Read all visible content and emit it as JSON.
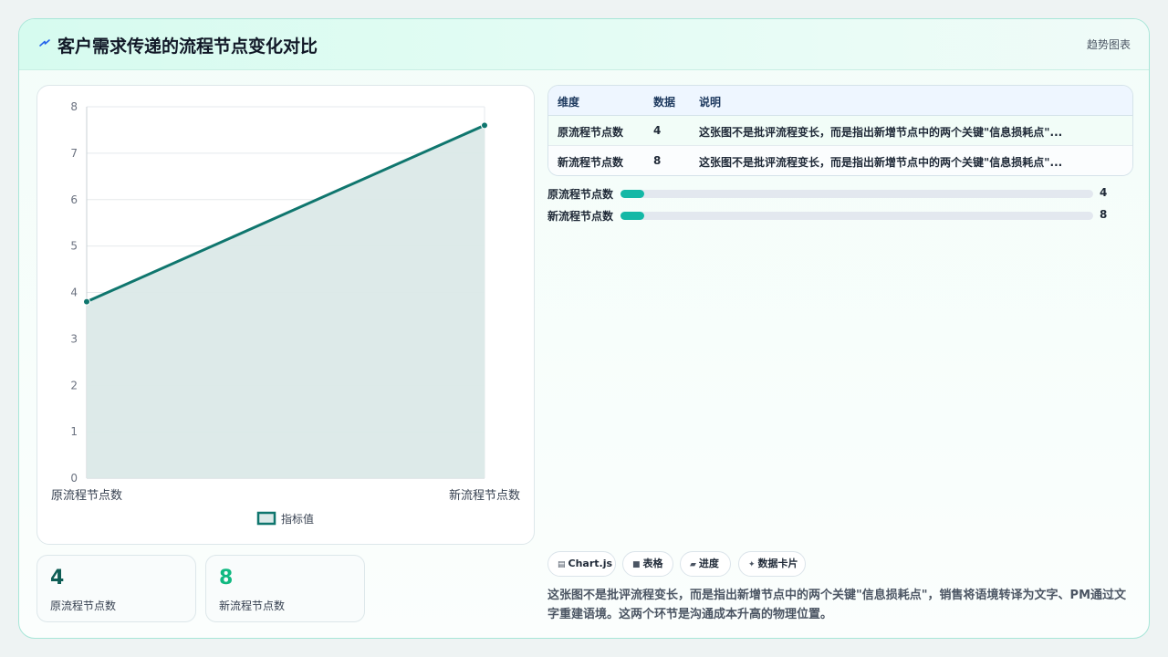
{
  "header": {
    "title": "客户需求传递的流程节点变化对比",
    "type_tag": "趋势图表",
    "icon": "lightning-icon"
  },
  "chart_data": {
    "type": "area",
    "categories": [
      "原流程节点数",
      "新流程节点数"
    ],
    "series": [
      {
        "name": "指标值",
        "values": [
          3.8,
          7.6
        ]
      }
    ],
    "ylim": [
      0,
      8
    ],
    "yticks": [
      0,
      1,
      2,
      3,
      4,
      5,
      6,
      7,
      8
    ],
    "grid": true,
    "legend_position": "bottom",
    "colors": {
      "line": "#0f766e",
      "fill": "#dbe9e8"
    }
  },
  "stats": [
    {
      "value": "4",
      "label": "原流程节点数",
      "color": "#0f5e56"
    },
    {
      "value": "8",
      "label": "新流程节点数",
      "color": "#10b981"
    }
  ],
  "table": {
    "headers": [
      "维度",
      "数据",
      "说明"
    ],
    "rows": [
      [
        "原流程节点数",
        "4",
        "这张图不是批评流程变长，而是指出新增节点中的两个关键\"信息损耗点\"..."
      ],
      [
        "新流程节点数",
        "8",
        "这张图不是批评流程变长，而是指出新增节点中的两个关键\"信息损耗点\"..."
      ]
    ]
  },
  "bars": [
    {
      "label": "原流程节点数",
      "value": "4",
      "fraction": 0.05
    },
    {
      "label": "新流程节点数",
      "value": "8",
      "fraction": 0.05
    }
  ],
  "pills": [
    {
      "icon": "chart-icon",
      "label": "Chart.js"
    },
    {
      "icon": "table-icon",
      "label": "表格"
    },
    {
      "icon": "progress-icon",
      "label": "进度"
    },
    {
      "icon": "sparkle-icon",
      "label": "数据卡片"
    }
  ],
  "description": "这张图不是批评流程变长，而是指出新增节点中的两个关键\"信息损耗点\"，销售将语境转译为文字、PM通过文字重建语境。这两个环节是沟通成本升高的物理位置。",
  "accent_color": "#14b8a6"
}
